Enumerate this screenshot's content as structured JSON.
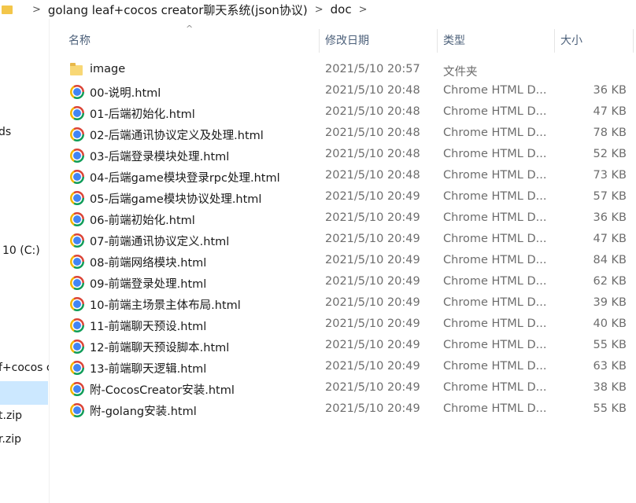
{
  "address_bar": {
    "crumbs": [
      "golang leaf+cocos creator聊天系统(json协议)",
      "doc"
    ]
  },
  "nav_pane": {
    "items": [
      "ds",
      "10 (C:)",
      "f+cocos c",
      "t.zip",
      "r.zip"
    ]
  },
  "columns": {
    "name": "名称",
    "date": "修改日期",
    "type": "类型",
    "size": "大小"
  },
  "files": [
    {
      "name": "image",
      "date": "2021/5/10 20:57",
      "type": "文件夹",
      "size": "",
      "icon": "folder-icon"
    },
    {
      "name": "00-说明.html",
      "date": "2021/5/10 20:48",
      "type": "Chrome HTML D...",
      "size": "36 KB",
      "icon": "chrome-icon"
    },
    {
      "name": "01-后端初始化.html",
      "date": "2021/5/10 20:48",
      "type": "Chrome HTML D...",
      "size": "47 KB",
      "icon": "chrome-icon"
    },
    {
      "name": "02-后端通讯协议定义及处理.html",
      "date": "2021/5/10 20:48",
      "type": "Chrome HTML D...",
      "size": "78 KB",
      "icon": "chrome-icon"
    },
    {
      "name": "03-后端登录模块处理.html",
      "date": "2021/5/10 20:48",
      "type": "Chrome HTML D...",
      "size": "52 KB",
      "icon": "chrome-icon"
    },
    {
      "name": "04-后端game模块登录rpc处理.html",
      "date": "2021/5/10 20:48",
      "type": "Chrome HTML D...",
      "size": "73 KB",
      "icon": "chrome-icon"
    },
    {
      "name": "05-后端game模块协议处理.html",
      "date": "2021/5/10 20:49",
      "type": "Chrome HTML D...",
      "size": "57 KB",
      "icon": "chrome-icon"
    },
    {
      "name": "06-前端初始化.html",
      "date": "2021/5/10 20:49",
      "type": "Chrome HTML D...",
      "size": "36 KB",
      "icon": "chrome-icon"
    },
    {
      "name": "07-前端通讯协议定义.html",
      "date": "2021/5/10 20:49",
      "type": "Chrome HTML D...",
      "size": "47 KB",
      "icon": "chrome-icon"
    },
    {
      "name": "08-前端网络模块.html",
      "date": "2021/5/10 20:49",
      "type": "Chrome HTML D...",
      "size": "84 KB",
      "icon": "chrome-icon"
    },
    {
      "name": "09-前端登录处理.html",
      "date": "2021/5/10 20:49",
      "type": "Chrome HTML D...",
      "size": "62 KB",
      "icon": "chrome-icon"
    },
    {
      "name": "10-前端主场景主体布局.html",
      "date": "2021/5/10 20:49",
      "type": "Chrome HTML D...",
      "size": "39 KB",
      "icon": "chrome-icon"
    },
    {
      "name": "11-前端聊天预设.html",
      "date": "2021/5/10 20:49",
      "type": "Chrome HTML D...",
      "size": "40 KB",
      "icon": "chrome-icon"
    },
    {
      "name": "12-前端聊天预设脚本.html",
      "date": "2021/5/10 20:49",
      "type": "Chrome HTML D...",
      "size": "55 KB",
      "icon": "chrome-icon"
    },
    {
      "name": "13-前端聊天逻辑.html",
      "date": "2021/5/10 20:49",
      "type": "Chrome HTML D...",
      "size": "63 KB",
      "icon": "chrome-icon"
    },
    {
      "name": "附-CocosCreator安装.html",
      "date": "2021/5/10 20:49",
      "type": "Chrome HTML D...",
      "size": "38 KB",
      "icon": "chrome-icon"
    },
    {
      "name": "附-golang安装.html",
      "date": "2021/5/10 20:49",
      "type": "Chrome HTML D...",
      "size": "55 KB",
      "icon": "chrome-icon"
    }
  ]
}
